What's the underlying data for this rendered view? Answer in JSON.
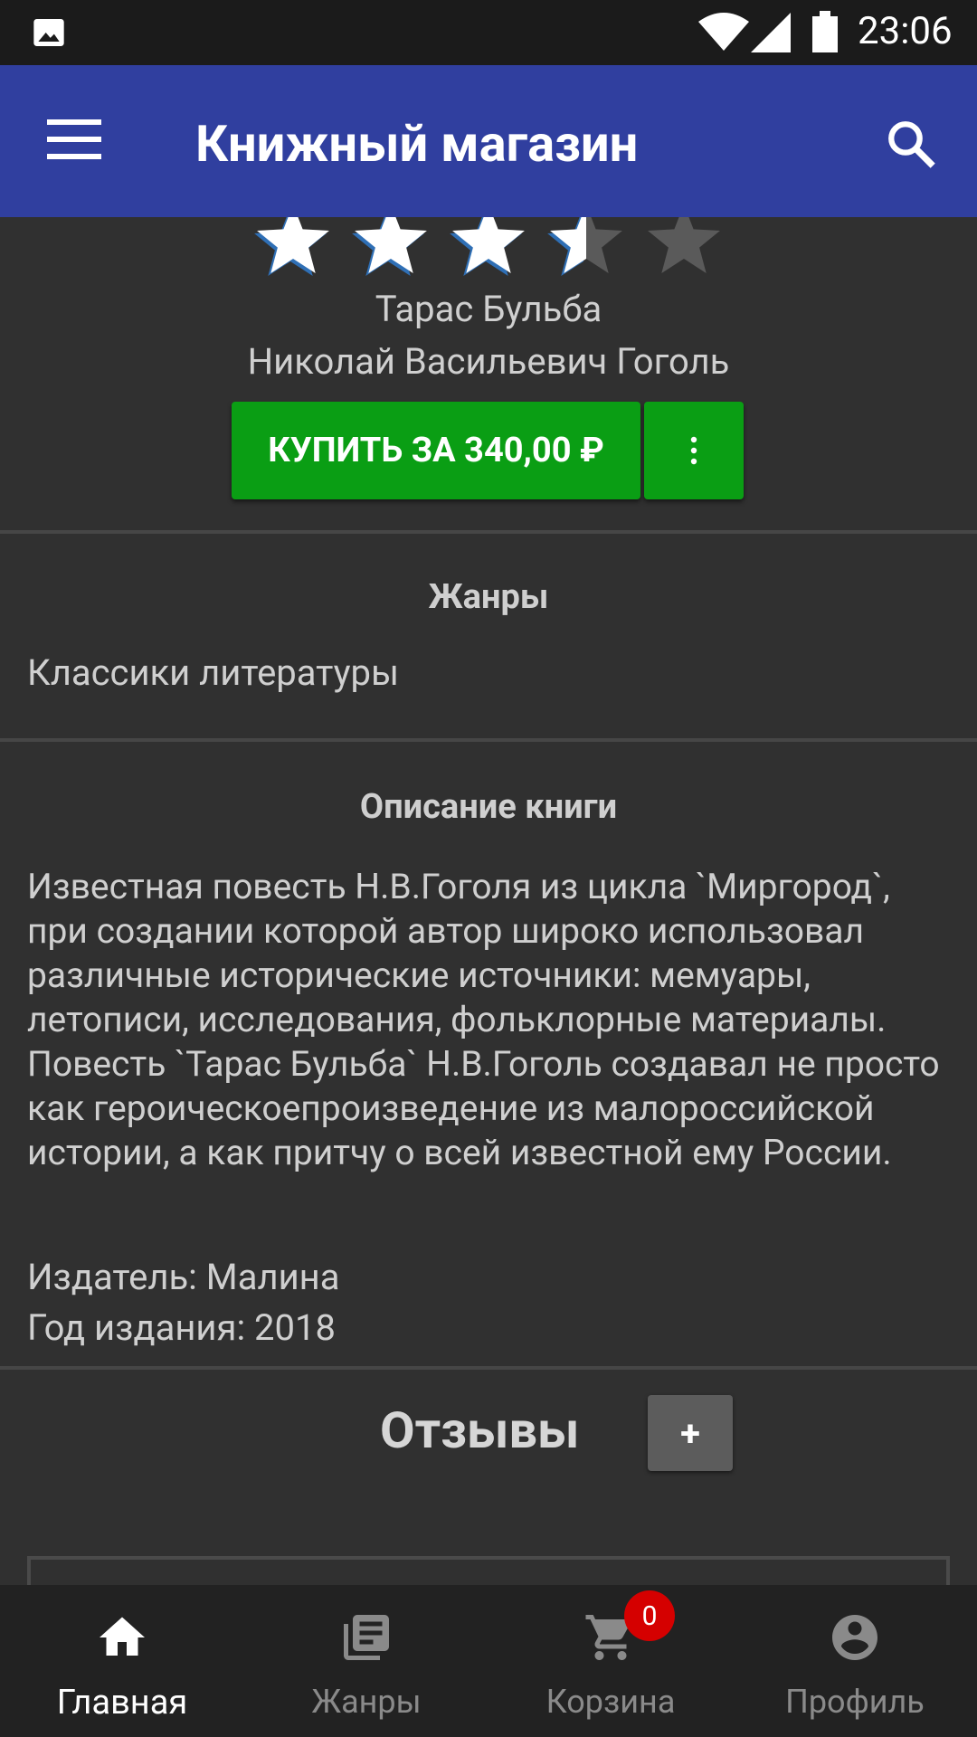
{
  "status_bar": {
    "time": "23:06"
  },
  "app_bar": {
    "title": "Книжный магазин"
  },
  "book": {
    "rating": 3.5,
    "max_rating": 5,
    "title": "Тарас Бульба",
    "author": "Николай Васильевич Гоголь",
    "buy_label": "КУПИТЬ ЗА 340,00 ₽"
  },
  "genres": {
    "heading": "Жанры",
    "value": "Классики литературы"
  },
  "description": {
    "heading": "Описание книги",
    "text": "Известная повесть Н.В.Гоголя из цикла `Миргород`, при создании которой автор широко использовал различные исторические источники: мемуары, летописи, исследования, фольклорные материалы. Повесть `Тарас Бульба` Н.В.Гоголь создавал не просто как героическоепроизведение из малороссийской истории, а как притчу о всей известной ему России.",
    "publisher": "Издатель: Малина",
    "year": "Год издания: 2018"
  },
  "reviews": {
    "heading": "Отзывы",
    "add_label": "+"
  },
  "bottom_nav": {
    "items": [
      {
        "label": "Главная",
        "icon": "home-icon",
        "active": true
      },
      {
        "label": "Жанры",
        "icon": "library-icon",
        "active": false
      },
      {
        "label": "Корзина",
        "icon": "cart-icon",
        "active": false,
        "badge": "0"
      },
      {
        "label": "Профиль",
        "icon": "account-icon",
        "active": false
      }
    ]
  },
  "colors": {
    "app_bar": "#303f9f",
    "buy_button": "#0a9e14",
    "badge": "#d50000",
    "background": "#303030"
  }
}
